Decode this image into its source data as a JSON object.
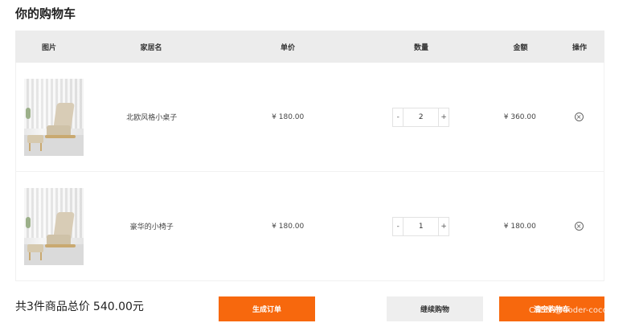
{
  "page_title": "你的购物车",
  "table": {
    "headers": {
      "image": "图片",
      "name": "家居名",
      "price": "单价",
      "quantity": "数量",
      "amount": "金额",
      "operation": "操作"
    },
    "rows": [
      {
        "name": "北欧风格小桌子",
        "price": "¥ 180.00",
        "quantity": "2",
        "amount": "¥ 360.00",
        "minus": "-",
        "plus": "+",
        "delete_icon": "close-circle-icon"
      },
      {
        "name": "豪华的小椅子",
        "price": "¥ 180.00",
        "quantity": "1",
        "amount": "¥ 180.00",
        "minus": "-",
        "plus": "+",
        "delete_icon": "close-circle-icon"
      }
    ]
  },
  "summary": {
    "label": "共3件商品总价",
    "total": "540.00元"
  },
  "buttons": {
    "create_order": "生成订单",
    "continue_shopping": "继续购物",
    "clear_cart": "清空购物车"
  },
  "watermark": "CSDN @Coder-coco",
  "colors": {
    "accent": "#f7680d",
    "header_bg": "#ececec",
    "secondary_button": "#eeeeee"
  }
}
